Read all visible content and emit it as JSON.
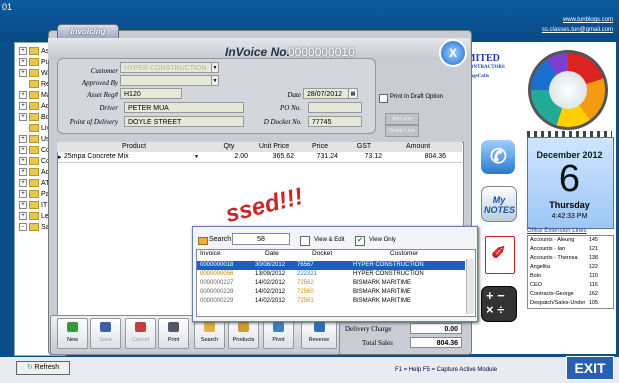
{
  "window": {
    "title_partial": "01",
    "links": [
      "www.tunblogs.com",
      "ss.classes.tun@gmail.com"
    ]
  },
  "left_tree": {
    "items": [
      "As",
      "Pu",
      "Wa",
      "Re",
      "Ma",
      "Ad",
      "Bo",
      "Liv",
      "Us",
      "Co",
      "Co",
      "Ac",
      "ATI",
      "Pa",
      "IT",
      "Le",
      "Sa"
    ]
  },
  "refresh_button": "Refresh",
  "invoice": {
    "tab_label": "Invoicing",
    "header_label": "InVoice No.",
    "header_number": "0000000010",
    "close_label": "X",
    "form": {
      "customer_label": "Customer",
      "customer_value": "HYPER CONSTRUCTION",
      "approved_by_label": "Approved By",
      "approved_by_value": "",
      "asset_reg_label": "Asset Reg#",
      "asset_reg_value": "H120",
      "date_label": "Date",
      "date_value": "28/07/2012",
      "driver_label": "Driver",
      "driver_value": "PETER MUA",
      "po_label": "PO No.",
      "po_value": "",
      "delivery_point_label": "Point of Delivery",
      "delivery_point_value": "DOYLE STREET",
      "docket_label": "D Docket No.",
      "docket_value": "77745",
      "draft_label": "Print In Draft Option",
      "btn_add": "Add Line",
      "btn_delete": "Delete Line"
    },
    "grid": {
      "headers": [
        "Product",
        "Qty",
        "Unit Price",
        "Price",
        "GST",
        "Amount"
      ],
      "rows": [
        {
          "product": "25mpa Concrete Mix",
          "qty": "2.00",
          "unit_price": "365.62",
          "price": "731.24",
          "gst": "73.12",
          "amount": "804.36"
        }
      ]
    },
    "stamp_text": "ssed!!!",
    "totals": {
      "delivery_label": "Delivery Charge",
      "delivery_value": "0.00",
      "total_label": "Total Sales",
      "total_value": "804.36"
    },
    "toolbar": {
      "new": "New",
      "save": "Save",
      "cancel": "Cancel",
      "print": "Print",
      "search": "Search",
      "products": "Products",
      "pivot": "Pivot",
      "reverse": "Reverse"
    }
  },
  "search_popup": {
    "search_label": "Search",
    "search_value": "58",
    "view_edit_label": "View & Edit",
    "view_only_label": "View Only",
    "headers": [
      "Invoice",
      "Date",
      "Docket",
      "Customer"
    ],
    "rows": [
      {
        "invoice": "0000000018",
        "date": "30/08/2012",
        "docket": "76567",
        "customer": "HYPER CONSTRUCTION"
      },
      {
        "invoice": "0000000056",
        "date": "13/09/2012",
        "docket": "222321",
        "customer": "HYPER CONSTRUCTION"
      },
      {
        "invoice": "0000000227",
        "date": "14/02/2012",
        "docket": "72562",
        "customer": "BISMARK MARITIME"
      },
      {
        "invoice": "0000000228",
        "date": "14/02/2012",
        "docket": "72560",
        "customer": "BISMARK MARITIME"
      },
      {
        "invoice": "0000000229",
        "date": "14/02/2012",
        "docket": "72561",
        "customer": "BISMARK MARITIME"
      }
    ]
  },
  "right_panel": {
    "logo_line1": "MITED",
    "logo_line2": "CONTRACTORS",
    "logo_line3": "BlogsCatts",
    "notes_label": "My NOTES",
    "calendar": {
      "month": "December 2012",
      "day": "6",
      "weekday": "Thursday",
      "time": "4:42:33 PM"
    },
    "ext_header": "Office Extension Lines",
    "extensions": [
      {
        "name": "Accounts - Aleung",
        "ext": "145"
      },
      {
        "name": "Accounts - Ian",
        "ext": "121"
      },
      {
        "name": "Accounts - Theresa",
        "ext": "138"
      },
      {
        "name": "Angelita",
        "ext": "122"
      },
      {
        "name": "Bolo",
        "ext": "110"
      },
      {
        "name": "CEO",
        "ext": "116"
      },
      {
        "name": "Contracts-George",
        "ext": "162"
      },
      {
        "name": "Despatch/Sales-Under",
        "ext": "105"
      }
    ]
  },
  "statusbar": {
    "help": "F1 = Help    F5 = Capture Active Module",
    "exit": "EXIT"
  },
  "colors": {
    "background": "#0a4e8a",
    "selected_row": "#1c5fc4",
    "stamp": "#c41010"
  }
}
